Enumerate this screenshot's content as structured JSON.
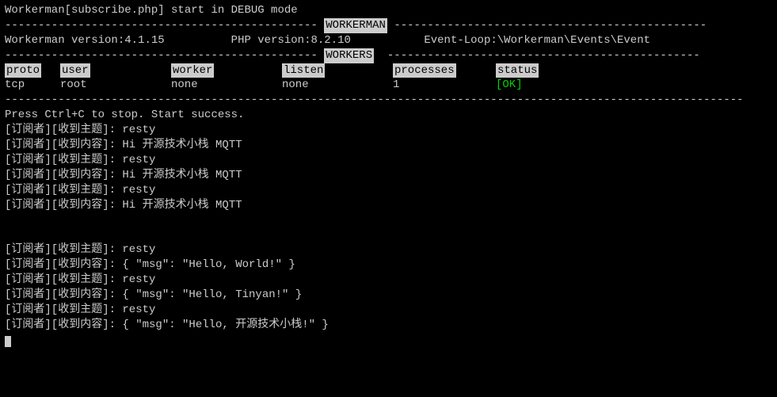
{
  "title_line": "Workerman[subscribe.php] start in DEBUG mode",
  "banner1": "WORKERMAN",
  "info": {
    "wm_label": "Workerman version:",
    "wm_ver": "4.1.15",
    "php_label": "PHP version:",
    "php_ver": "8.2.10",
    "loop_label": "Event-Loop:",
    "loop_val": "\\Workerman\\Events\\Event"
  },
  "banner2": "WORKERS",
  "columns": {
    "proto_h": "proto",
    "user_h": "user",
    "worker_h": "worker",
    "listen_h": "listen",
    "proc_h": "processes",
    "status_h": "status",
    "proto_v": "tcp",
    "user_v": "root",
    "worker_v": "none",
    "listen_v": "none",
    "proc_v": "1",
    "status_v": "[OK]"
  },
  "press_line": "Press Ctrl+C to stop. Start success.",
  "log_block1": [
    "[订阅者][收到主题]: resty",
    "[订阅者][收到内容]: Hi 开源技术小栈 MQTT",
    "[订阅者][收到主题]: resty",
    "[订阅者][收到内容]: Hi 开源技术小栈 MQTT",
    "[订阅者][收到主题]: resty",
    "[订阅者][收到内容]: Hi 开源技术小栈 MQTT"
  ],
  "log_block2": [
    "[订阅者][收到主题]: resty",
    "[订阅者][收到内容]: { \"msg\": \"Hello, World!\" }",
    "[订阅者][收到主题]: resty",
    "[订阅者][收到内容]: { \"msg\": \"Hello, Tinyan!\" }",
    "[订阅者][收到主题]: resty",
    "[订阅者][收到内容]: { \"msg\": \"Hello, 开源技术小栈!\" }"
  ],
  "dash_left": "-----------------------------------------------",
  "dash_right": "----------------------------------------------- ",
  "dash_full": "---------------------------------------------------------------------------------------------------------------"
}
